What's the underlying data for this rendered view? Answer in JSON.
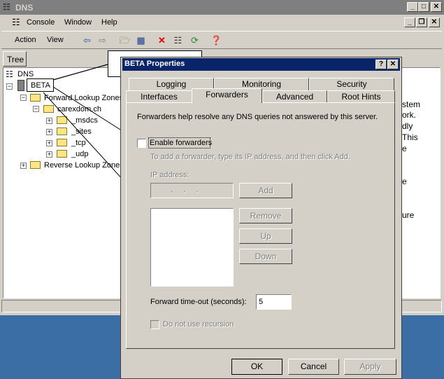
{
  "window": {
    "title": "DNS"
  },
  "menu": {
    "console": "Console",
    "window": "Window",
    "help": "Help"
  },
  "toolbar": {
    "action": "Action",
    "view": "View"
  },
  "tree": {
    "tab_label": "Tree",
    "root": "DNS",
    "server": "BETA",
    "forward_zones": "Forward Lookup Zones",
    "zone": "carexdom.ch",
    "children": [
      "_msdcs",
      "_sites",
      "_tcp",
      "_udp"
    ],
    "reverse_zones": "Reverse Lookup Zones"
  },
  "right_pane_fragments": [
    "stem",
    "ork.",
    "dly",
    "This",
    "e",
    "e",
    "ure"
  ],
  "dialog": {
    "title": "BETA Properties",
    "help_btn": "?",
    "close_btn": "✕",
    "tabs_row1": [
      "Logging",
      "Monitoring",
      "Security"
    ],
    "tabs_row2": [
      "Interfaces",
      "Forwarders",
      "Advanced",
      "Root Hints"
    ],
    "selected_tab": "Forwarders",
    "description": "Forwarders help resolve any DNS queries not answered by this server.",
    "enable_forwarders": "Enable forwarders",
    "enable_forwarders_checked": false,
    "instruction": "To add a forwarder, type its IP address, and then click Add.",
    "ip_label": "IP address:",
    "ip_placeholder": ".    .    .",
    "add_btn": "Add",
    "remove_btn": "Remove",
    "up_btn": "Up",
    "down_btn": "Down",
    "timeout_label": "Forward time-out (seconds):",
    "timeout_value": "5",
    "no_recursion": "Do not use recursion",
    "ok_btn": "OK",
    "cancel_btn": "Cancel",
    "apply_btn": "Apply"
  },
  "colors": {
    "desktop": "#3a6ea5",
    "face": "#d4d0c8",
    "active_title": "#0a246a",
    "inactive_title": "#7f7f7f"
  }
}
